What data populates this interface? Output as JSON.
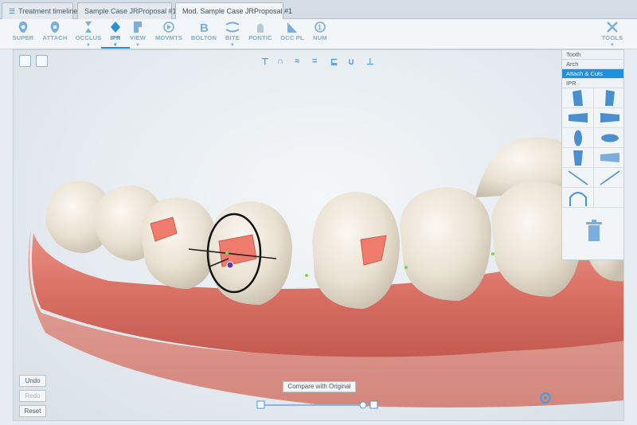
{
  "tabs": [
    {
      "label": "Treatment timeline",
      "icon": "timeline-icon"
    },
    {
      "label": "Sample Case JRProposal #1"
    },
    {
      "label": "Mod. Sample Case JRProposal #1"
    }
  ],
  "toolbar": {
    "tools": [
      "SUPER",
      "ATTACH",
      "OCCLUS",
      "IPR",
      "VIEW",
      "MOVMTS",
      "BOLTON",
      "BITE",
      "PONTIC",
      "OCC PL",
      "NUM"
    ],
    "right_tool": "TOOLS",
    "active_tool": "IPR"
  },
  "panel": {
    "tabs": [
      "Tooth",
      "Arch",
      "Attach & Cuts",
      "IPR"
    ],
    "selected_tab": "Attach & Cuts"
  },
  "buttons": {
    "undo": "Undo",
    "redo": "Redo",
    "reset": "Reset",
    "compare": "Compare with Original"
  },
  "colors": {
    "accent": "#2d8fd6",
    "gum": "#e07a6f",
    "tooth": "#ece4d6",
    "attachment": "#ef7b6c"
  }
}
